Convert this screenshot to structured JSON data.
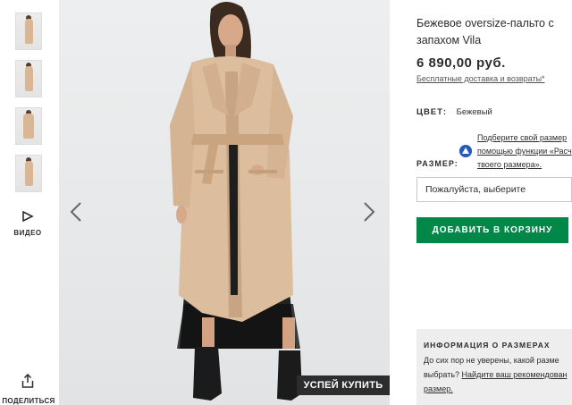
{
  "thumbnails": [
    {
      "name": "thumb-1"
    },
    {
      "name": "thumb-2"
    },
    {
      "name": "thumb-3"
    },
    {
      "name": "thumb-4"
    }
  ],
  "video_label": "ВИДЕО",
  "share_label": "ПОДЕЛИТЬСЯ",
  "hurry_badge": "УСПЕЙ КУПИТЬ",
  "product": {
    "title_line1": "Бежевое oversize-пальто с",
    "title_line2": "запахом Vila",
    "price": "6 890,00 руб.",
    "delivery_link": "Бесплатные доставка и возвраты*",
    "color_label": "ЦВЕТ:",
    "color_value": "Бежевый",
    "fit_line1": "Подберите свой размер",
    "fit_line2": "помощью функции «Расч",
    "fit_line3": "твоего размера».",
    "size_label": "РАЗМЕР:",
    "size_placeholder": "Пожалуйста, выберите",
    "add_to_cart": "ДОБАВИТЬ В КОРЗИНУ"
  },
  "size_info": {
    "heading": "ИНФОРМАЦИЯ О РАЗМЕРАХ",
    "line1": "До сих пор не уверены, какой разме",
    "line2_prefix": "выбрать? ",
    "line2_link": "Найдите ваш рекомендован",
    "line3_link": "размер."
  },
  "colors": {
    "accent_green": "#018849",
    "dark_badge": "#2d2d2d",
    "coat": "#dcbd9d"
  }
}
